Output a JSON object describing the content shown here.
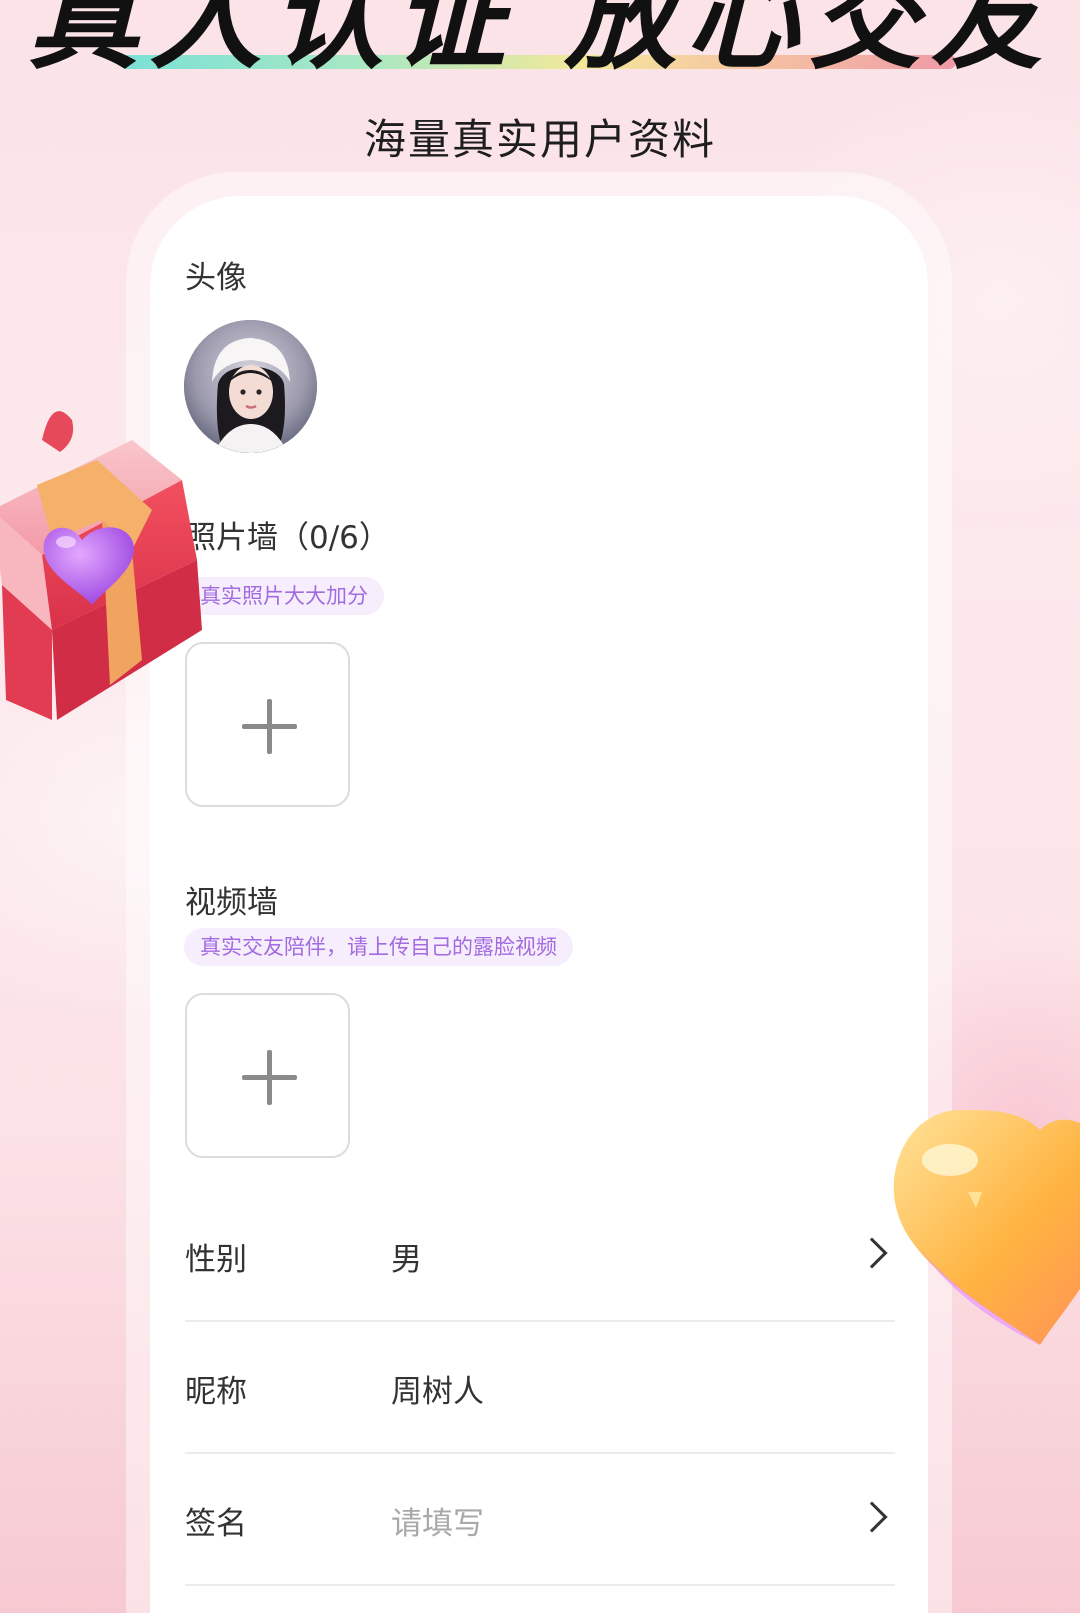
{
  "banner": {
    "title": "真人认证 放心交友",
    "subtitle": "海量真实用户资料"
  },
  "avatar_section": {
    "label": "头像"
  },
  "photo_wall": {
    "label": "照片墙（0/6）",
    "hint": "真实照片大大加分"
  },
  "video_wall": {
    "label": "视频墙",
    "hint": "真实交友陪伴，请上传自己的露脸视频"
  },
  "fields": [
    {
      "label": "性别",
      "value": "男"
    },
    {
      "label": "昵称",
      "value": "周树人"
    },
    {
      "label": "签名",
      "value": "请填写"
    }
  ],
  "colors": {
    "accent_purple": "#a36be0",
    "hint_bg": "#f6eefc",
    "background_pink": "#fbe3e8"
  }
}
